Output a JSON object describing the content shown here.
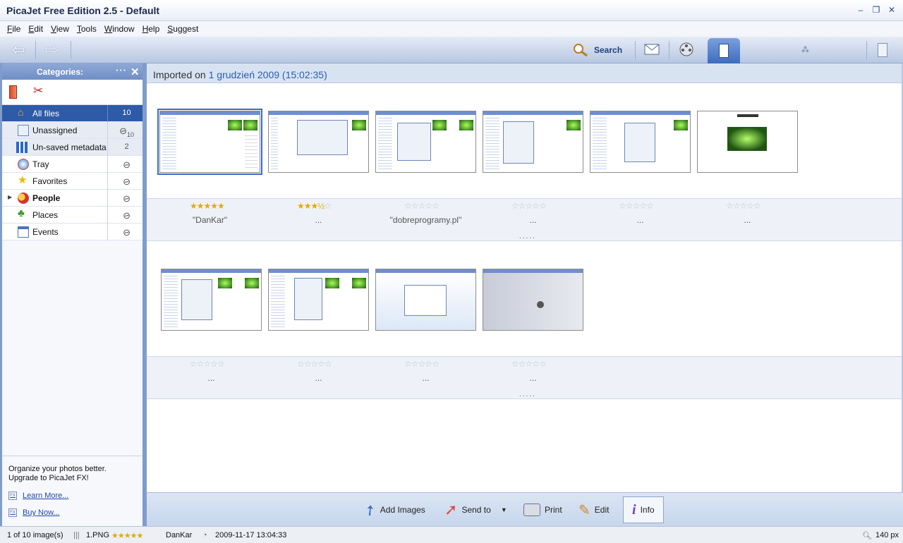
{
  "window": {
    "title": "PicaJet Free Edition 2.5  - Default"
  },
  "menu": [
    "File",
    "Edit",
    "View",
    "Tools",
    "Window",
    "Help",
    "Suggest"
  ],
  "toolbar": {
    "search_label": "Search"
  },
  "sidebar": {
    "title": "Categories:",
    "categories": [
      {
        "label": "All files",
        "count": "10"
      },
      {
        "label": "Unassigned",
        "count": "10"
      },
      {
        "label": "Un-saved metadata",
        "count": "2"
      },
      {
        "label": "Tray"
      },
      {
        "label": "Favorites"
      },
      {
        "label": "People"
      },
      {
        "label": "Places"
      },
      {
        "label": "Events"
      }
    ],
    "promo": {
      "line1": "Organize your photos better.",
      "line2": "Upgrade to PicaJet FX!",
      "learn_more": "Learn More...",
      "buy_now": "Buy Now..."
    }
  },
  "group": {
    "prefix": "Imported on",
    "date": "1 grudzień 2009 (15:02:35)"
  },
  "images": [
    {
      "rating": 5,
      "caption": "\"DanKar\""
    },
    {
      "rating": 3.5,
      "caption": "..."
    },
    {
      "rating": 0,
      "caption": "\"dobreprogramy.pl\""
    },
    {
      "rating": 0,
      "caption": "..."
    },
    {
      "rating": 0,
      "caption": "..."
    },
    {
      "rating": 0,
      "caption": "..."
    },
    {
      "rating": 0,
      "caption": "..."
    },
    {
      "rating": 0,
      "caption": "..."
    },
    {
      "rating": 0,
      "caption": "..."
    },
    {
      "rating": 0,
      "caption": "..."
    }
  ],
  "row_dots": ".....",
  "actions": {
    "add_images": "Add Images",
    "send_to": "Send to",
    "print": "Print",
    "edit": "Edit",
    "info": "Info"
  },
  "status": {
    "count": "1 of 10 image(s)",
    "filename": "1.PNG",
    "rating": "★★★★★",
    "author": "DanKar",
    "datetime": "2009-11-17 13:04:33",
    "zoom": "140 px"
  },
  "colors": {
    "accent": "#2e5aa8",
    "frame": "#7f9ccc",
    "star": "#e2ab00"
  }
}
